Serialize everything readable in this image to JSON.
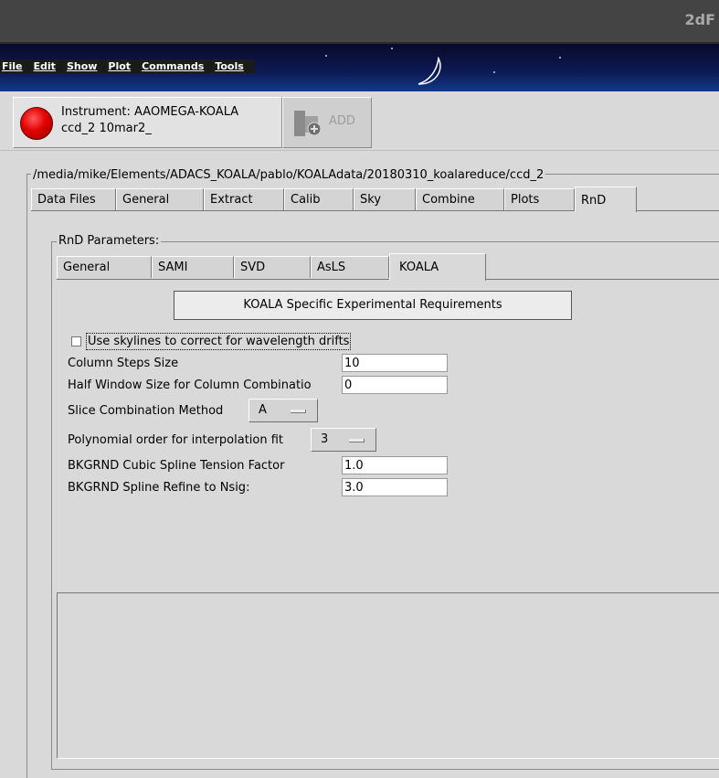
{
  "window": {
    "title": "2dF"
  },
  "menubar": {
    "items": [
      "File",
      "Edit",
      "Show",
      "Plot",
      "Commands",
      "Tools"
    ]
  },
  "instrument": {
    "label": "Instrument: AAOMEGA-KOALA",
    "sublabel": "ccd_2  10mar2_",
    "status_color": "#e20000",
    "add_label": "ADD"
  },
  "path": "/media/mike/Elements/ADACS_KOALA/pablo/KOALAdata/20180310_koalareduce/ccd_2",
  "main_tabs": [
    "Data Files",
    "General",
    "Extract",
    "Calib",
    "Sky",
    "Combine",
    "Plots",
    "RnD"
  ],
  "main_tab_active": "RnD",
  "rnd": {
    "group_label": "RnD Parameters:",
    "tabs": [
      "General",
      "SAMI",
      "SVD",
      "AsLS",
      "KOALA"
    ],
    "active_tab": "KOALA",
    "koala": {
      "header_button": "KOALA Specific Experimental Requirements",
      "use_skylines_label": "Use skylines to correct for wavelength drifts",
      "use_skylines_checked": false,
      "column_steps_label": "Column Steps Size",
      "column_steps_value": "10",
      "half_window_label": "Half Window Size for Column Combinatio",
      "half_window_value": "0",
      "slice_method_label": "Slice Combination Method",
      "slice_method_value": "A",
      "poly_order_label": "Polynomial order for interpolation fit",
      "poly_order_value": "3",
      "bkg_tension_label": "BKGRND Cubic Spline Tension Factor",
      "bkg_tension_value": "1.0",
      "bkg_refine_label": "BKGRND Spline Refine to Nsig:",
      "bkg_refine_value": "3.0"
    }
  }
}
